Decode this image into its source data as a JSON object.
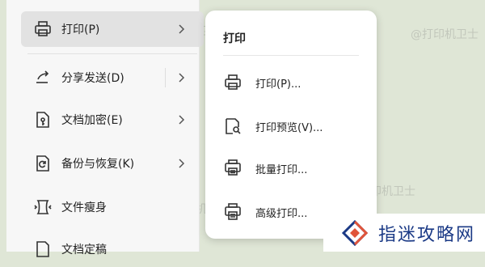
{
  "left_menu": {
    "items": [
      {
        "label": "打印(P)"
      },
      {
        "label": "分享发送(D)"
      },
      {
        "label": "文档加密(E)"
      },
      {
        "label": "备份与恢复(K)"
      },
      {
        "label": "文件瘦身"
      },
      {
        "label": "文档定稿"
      }
    ]
  },
  "popup": {
    "title": "打印",
    "items": [
      {
        "label": "打印(P)..."
      },
      {
        "label": "打印预览(V)..."
      },
      {
        "label": "批量打印..."
      },
      {
        "label": "高级打印..."
      }
    ]
  },
  "watermark": {
    "text": "@打印机卫士"
  },
  "brand": {
    "name": "指迷攻略网"
  }
}
